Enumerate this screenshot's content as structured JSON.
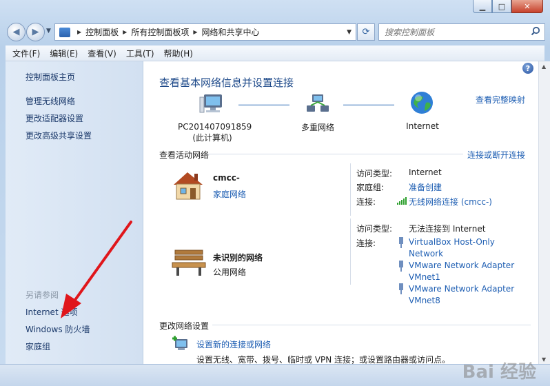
{
  "window": {
    "minimize_icon": "minimize-icon",
    "maximize_icon": "maximize-icon",
    "close_icon": "close-icon"
  },
  "nav": {
    "back_icon": "back-arrow-icon",
    "forward_icon": "forward-arrow-icon",
    "breadcrumbs": [
      "控制面板",
      "所有控制面板项",
      "网络和共享中心"
    ],
    "search_placeholder": "搜索控制面板"
  },
  "menu": [
    "文件(F)",
    "编辑(E)",
    "查看(V)",
    "工具(T)",
    "帮助(H)"
  ],
  "sidebar": {
    "home": "控制面板主页",
    "items": [
      "管理无线网络",
      "更改适配器设置",
      "更改高级共享设置"
    ],
    "see_also_title": "另请参阅",
    "see_also": [
      "Internet 选项",
      "Windows 防火墙",
      "家庭组"
    ]
  },
  "main": {
    "title": "查看基本网络信息并设置连接",
    "full_map_link": "查看完整映射",
    "map": {
      "computer_name": "PC201407091859",
      "computer_sub": "(此计算机)",
      "middle": "多重网络",
      "internet": "Internet"
    },
    "active_networks_header": "查看活动网络",
    "connect_link": "连接或断开连接",
    "networks": [
      {
        "name": "cmcc-",
        "type_link": "家庭网络",
        "access_type_label": "访问类型:",
        "access_type": "Internet",
        "homegroup_label": "家庭组:",
        "homegroup": "准备创建",
        "connection_label": "连接:",
        "connection": "无线网络连接 (cmcc-)"
      },
      {
        "name": "未识别的网络",
        "type": "公用网络",
        "access_type_label": "访问类型:",
        "access_type": "无法连接到 Internet",
        "connection_label": "连接:",
        "connections": [
          [
            "VirtualBox Host-Only",
            "Network"
          ],
          [
            "VMware Network Adapter",
            "VMnet1"
          ],
          [
            "VMware Network Adapter",
            "VMnet8"
          ]
        ]
      }
    ],
    "change_settings_header": "更改网络设置",
    "setup_link": "设置新的连接或网络",
    "setup_desc": "设置无线、宽带、拨号、临时或 VPN 连接；或设置路由器或访问点。"
  },
  "watermark": "Bai 经验",
  "colors": {
    "link": "#1f5fb3",
    "title": "#1e4a8a",
    "annotation_arrow": "#e0161b"
  }
}
